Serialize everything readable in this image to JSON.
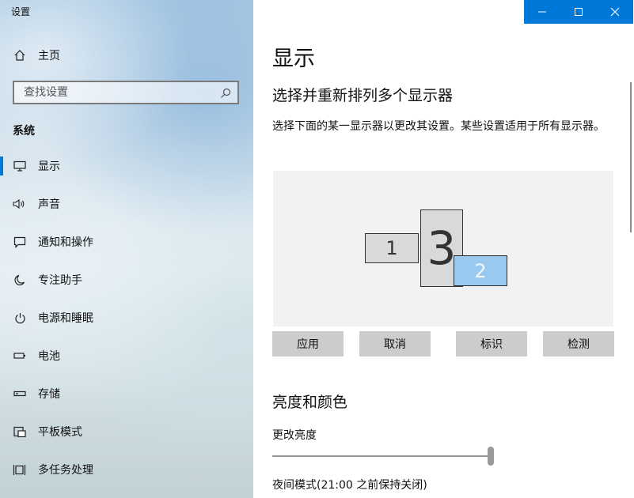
{
  "window": {
    "title": "设置"
  },
  "sidebar": {
    "home_label": "主页",
    "search_placeholder": "查找设置",
    "section_label": "系统",
    "items": [
      {
        "label": "显示",
        "icon": "monitor-icon",
        "active": true
      },
      {
        "label": "声音",
        "icon": "speaker-icon"
      },
      {
        "label": "通知和操作",
        "icon": "message-icon"
      },
      {
        "label": "专注助手",
        "icon": "moon-icon"
      },
      {
        "label": "电源和睡眠",
        "icon": "power-icon"
      },
      {
        "label": "电池",
        "icon": "battery-icon"
      },
      {
        "label": "存储",
        "icon": "storage-icon"
      },
      {
        "label": "平板模式",
        "icon": "tablet-icon"
      },
      {
        "label": "多任务处理",
        "icon": "multitask-icon"
      }
    ]
  },
  "main": {
    "title": "显示",
    "arrange_heading": "选择并重新排列多个显示器",
    "arrange_desc": "选择下面的某一显示器以更改其设置。某些设置适用于所有显示器。",
    "monitors": [
      {
        "number": "1",
        "selected": false
      },
      {
        "number": "3",
        "selected": false
      },
      {
        "number": "2",
        "selected": true
      }
    ],
    "buttons": {
      "apply": "应用",
      "cancel": "取消",
      "identify": "标识",
      "detect": "检测"
    },
    "brightness_heading": "亮度和颜色",
    "brightness_label": "更改亮度",
    "brightness_level": 1.0,
    "night_light": "夜间模式(21:00 之前保持关闭)"
  },
  "colors": {
    "accent": "#0078d7",
    "selected_monitor": "#99c9ef",
    "monitor": "#d9d9d9"
  }
}
